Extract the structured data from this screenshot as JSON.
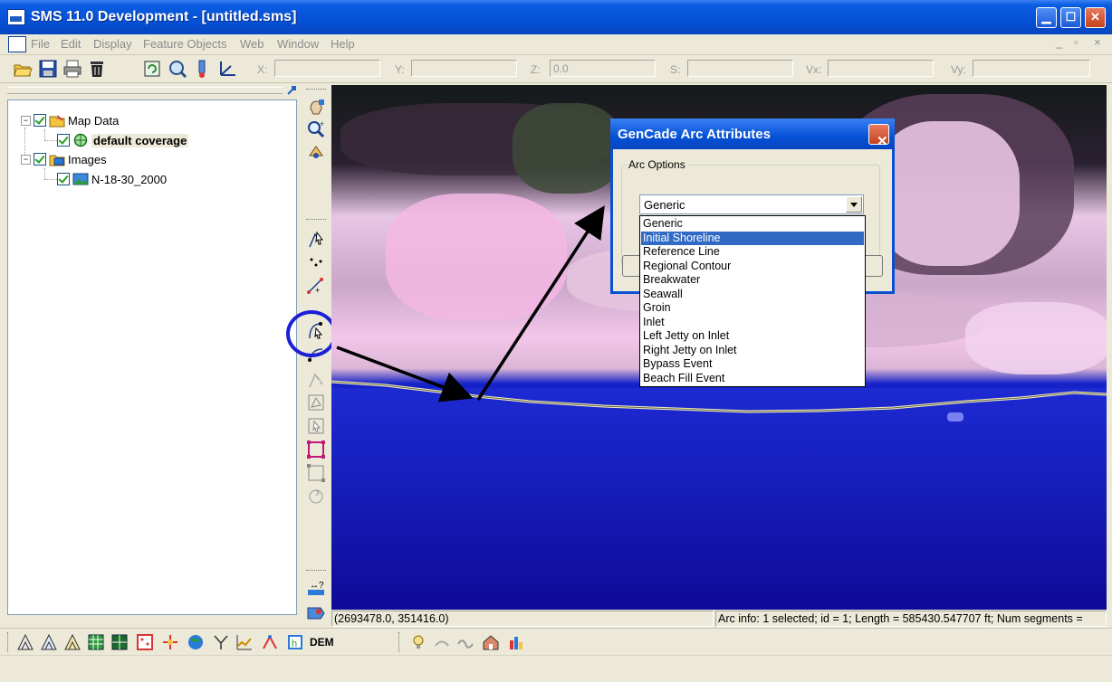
{
  "window": {
    "title": "SMS 11.0 Development - [untitled.sms]",
    "minimize_icon": "minimize-icon",
    "maximize_icon": "maximize-icon",
    "close_icon": "close-icon"
  },
  "menu": {
    "items": [
      "File",
      "Edit",
      "Display",
      "Feature Objects",
      "Web",
      "Window",
      "Help"
    ]
  },
  "toolbar": {
    "x_label": "X:",
    "y_label": "Y:",
    "z_label": "Z:",
    "z_value": "0.0",
    "s_label": "S:",
    "vx_label": "Vx:",
    "vy_label": "Vy:"
  },
  "tree": {
    "map_data": "Map Data",
    "default_coverage": "default coverage",
    "images": "Images",
    "image_item": "N-18-30_2000"
  },
  "dialog": {
    "title": "GenCade Arc Attributes",
    "group_label": "Arc Options",
    "selected_value": "Generic",
    "options": [
      "Generic",
      "Initial Shoreline",
      "Reference Line",
      "Regional Contour",
      "Breakwater",
      "Seawall",
      "Groin",
      "Inlet",
      "Left Jetty on Inlet",
      "Right Jetty on Inlet",
      "Bypass Event",
      "Beach Fill Event"
    ],
    "highlighted_index": 1
  },
  "status": {
    "coords": "(2693478.0, 351416.0)",
    "arc_info": "Arc info: 1 selected; id = 1; Length = 585430.547707 ft; Num segments ="
  },
  "bottom": {
    "dem_label": "DEM"
  },
  "colors": {
    "title_blue": "#0551d6",
    "highlight_blue": "#316ac5",
    "water_blue": "#1422c8",
    "annotation_circle": "#1a20d8"
  }
}
